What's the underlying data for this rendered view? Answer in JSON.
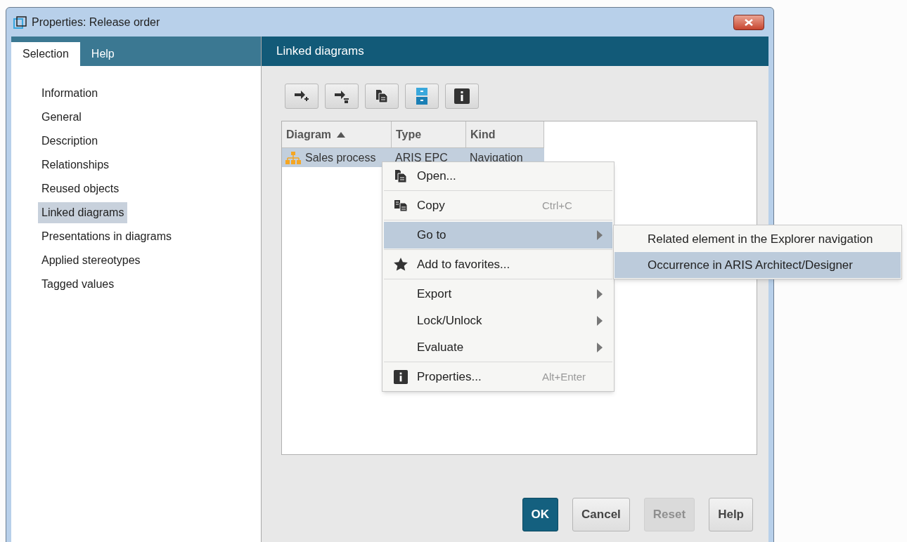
{
  "window": {
    "title": "Properties: Release order"
  },
  "tabs": [
    {
      "label": "Selection",
      "selected": true
    },
    {
      "label": "Help",
      "selected": false
    }
  ],
  "sidebar": {
    "items": [
      {
        "label": "Information",
        "selected": false
      },
      {
        "label": "General",
        "selected": false
      },
      {
        "label": "Description",
        "selected": false
      },
      {
        "label": "Relationships",
        "selected": false
      },
      {
        "label": "Reused objects",
        "selected": false
      },
      {
        "label": "Linked diagrams",
        "selected": true
      },
      {
        "label": "Presentations in diagrams",
        "selected": false
      },
      {
        "label": "Applied stereotypes",
        "selected": false
      },
      {
        "label": "Tagged values",
        "selected": false
      }
    ]
  },
  "panel": {
    "title": "Linked diagrams"
  },
  "table": {
    "columns": [
      {
        "label": "Diagram",
        "sorted": true
      },
      {
        "label": "Type",
        "sorted": false
      },
      {
        "label": "Kind",
        "sorted": false
      }
    ],
    "rows": [
      {
        "selected": true,
        "cells": [
          "Sales process",
          "ARIS EPC",
          "Navigation"
        ]
      }
    ]
  },
  "context_menu": {
    "items": [
      {
        "kind": "item",
        "label": "Open...",
        "selected": false
      },
      {
        "kind": "separator"
      },
      {
        "kind": "item",
        "label": "Copy",
        "shortcut": "Ctrl+C",
        "selected": false
      },
      {
        "kind": "separator"
      },
      {
        "kind": "item",
        "label": "Go to",
        "submenu": true,
        "selected": true
      },
      {
        "kind": "separator"
      },
      {
        "kind": "item",
        "label": "Add to favorites...",
        "selected": false
      },
      {
        "kind": "separator"
      },
      {
        "kind": "item",
        "label": "Export",
        "submenu": true,
        "selected": false
      },
      {
        "kind": "item",
        "label": "Lock/Unlock",
        "submenu": true,
        "selected": false
      },
      {
        "kind": "item",
        "label": "Evaluate",
        "submenu": true,
        "selected": false
      },
      {
        "kind": "separator"
      },
      {
        "kind": "item",
        "label": "Properties...",
        "shortcut": "Alt+Enter",
        "selected": false
      }
    ]
  },
  "submenu": {
    "items": [
      {
        "label": "Related element in the Explorer navigation",
        "selected": false
      },
      {
        "label": "Occurrence in ARIS Architect/Designer",
        "selected": true
      }
    ]
  },
  "buttons": [
    {
      "label": "OK",
      "kind": "primary",
      "disabled": false
    },
    {
      "label": "Cancel",
      "kind": "normal",
      "disabled": false
    },
    {
      "label": "Reset",
      "kind": "normal",
      "disabled": true
    },
    {
      "label": "Help",
      "kind": "normal",
      "disabled": false
    }
  ]
}
